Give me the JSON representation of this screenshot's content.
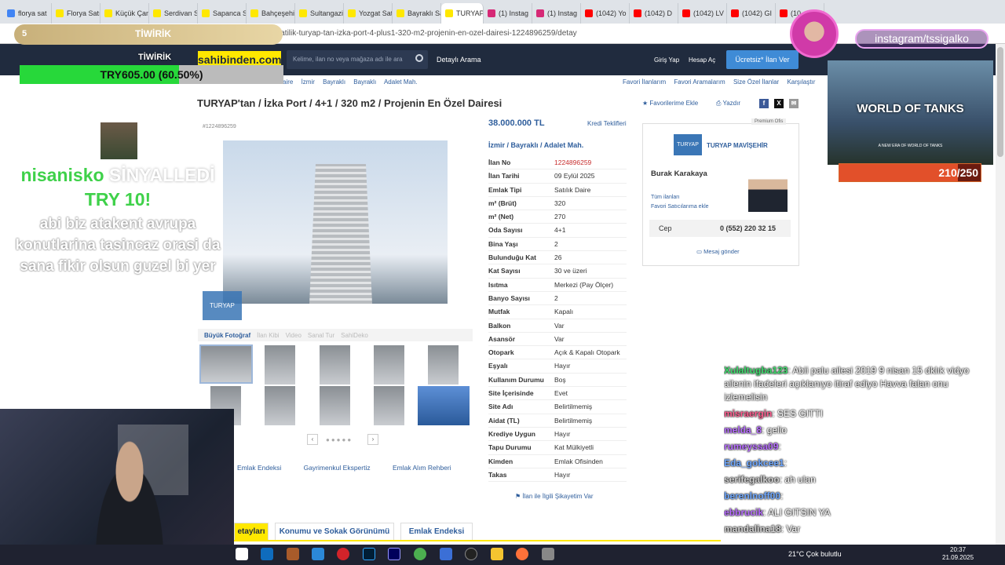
{
  "browser": {
    "tabs": [
      {
        "label": "florya sat",
        "color": "#4285f4"
      },
      {
        "label": "Florya Satılık",
        "color": "#ffe800"
      },
      {
        "label": "Küçük Çamlı",
        "color": "#ffe800"
      },
      {
        "label": "Serdivan Sat",
        "color": "#ffe800"
      },
      {
        "label": "Sapanca Satı",
        "color": "#ffe800"
      },
      {
        "label": "Bahçeşehir S",
        "color": "#ffe800"
      },
      {
        "label": "Sultangazi Sa",
        "color": "#ffe800"
      },
      {
        "label": "Yozgat Satılık",
        "color": "#ffe800"
      },
      {
        "label": "Bayraklı Satıl",
        "color": "#ffe800"
      },
      {
        "label": "TURYAP'ta",
        "color": "#ffe800",
        "active": true
      },
      {
        "label": "(1) Instag",
        "color": "#d62976"
      },
      {
        "label": "(1) Instag",
        "color": "#d62976"
      },
      {
        "label": "(1042) Yo",
        "color": "#ff0000"
      },
      {
        "label": "(1042) D",
        "color": "#ff0000"
      },
      {
        "label": "(1042) LV",
        "color": "#ff0000"
      },
      {
        "label": "(1042) GI",
        "color": "#ff0000"
      },
      {
        "label": "(10",
        "color": "#ff0000"
      }
    ],
    "url": "mlak-konut-satilik-turyap-tan-izka-port-4-plus1-320-m2-projenin-en-ozel-dairesi-1224896259/detay",
    "url_prefix": "en.com/ila"
  },
  "site": {
    "logo": "sahibinden.com",
    "search_placeholder": "Kelime, ilan no veya mağaza adı ile ara",
    "advanced_search": "Detaylı Arama",
    "login": "Giriş Yap",
    "register": "Hesap Aç",
    "post_ad": "Ücretsiz* İlan Ver"
  },
  "breadcrumb": [
    "aire",
    "İzmir",
    "Bayraklı",
    "Bayraklı",
    "Adalet Mah."
  ],
  "right_links": [
    "Favori İlanlarım",
    "Favori Aramalarım",
    "Size Özel İlanlar",
    "Karşılaştır"
  ],
  "listing": {
    "title": "TURYAP'tan / İzka Port / 4+1 / 320 m2 / Projenin En Özel Dairesi",
    "add_favorite": "Favorilerime Ekle",
    "print": "Yazdır",
    "listing_no_label": "#1224896259",
    "price": "38.000.000 TL",
    "credit": "Kredi Teklifleri",
    "location": "İzmir  /  Bayraklı  /  Adalet Mah.",
    "details": [
      {
        "k": "İlan No",
        "v": "1224896259",
        "red": true
      },
      {
        "k": "İlan Tarihi",
        "v": "09 Eylül 2025"
      },
      {
        "k": "Emlak Tipi",
        "v": "Satılık Daire"
      },
      {
        "k": "m² (Brüt)",
        "v": "320"
      },
      {
        "k": "m² (Net)",
        "v": "270"
      },
      {
        "k": "Oda Sayısı",
        "v": "4+1"
      },
      {
        "k": "Bina Yaşı",
        "v": "2"
      },
      {
        "k": "Bulunduğu Kat",
        "v": "26"
      },
      {
        "k": "Kat Sayısı",
        "v": "30 ve üzeri"
      },
      {
        "k": "Isıtma",
        "v": "Merkezi (Pay Ölçer)"
      },
      {
        "k": "Banyo Sayısı",
        "v": "2"
      },
      {
        "k": "Mutfak",
        "v": "Kapalı"
      },
      {
        "k": "Balkon",
        "v": "Var"
      },
      {
        "k": "Asansör",
        "v": "Var"
      },
      {
        "k": "Otopark",
        "v": "Açık & Kapalı Otopark"
      },
      {
        "k": "Eşyalı",
        "v": "Hayır"
      },
      {
        "k": "Kullanım Durumu",
        "v": "Boş"
      },
      {
        "k": "Site İçerisinde",
        "v": "Evet"
      },
      {
        "k": "Site Adı",
        "v": "Belirtilmemiş"
      },
      {
        "k": "Aidat (TL)",
        "v": "Belirtilmemiş"
      },
      {
        "k": "Krediye Uygun",
        "v": "Hayır"
      },
      {
        "k": "Tapu Durumu",
        "v": "Kat Mülkiyetli"
      },
      {
        "k": "Kimden",
        "v": "Emlak Ofisinden"
      },
      {
        "k": "Takas",
        "v": "Hayır"
      }
    ],
    "complaint": "İlan ile İlgili Şikayetim Var",
    "gallery_tabs": [
      "Büyük Fotoğraf",
      "İlan Kibi",
      "Video",
      "Sanal Tur",
      "SahiDeko"
    ],
    "watermark": "TURYAP MAVİŞEHİR"
  },
  "seller": {
    "premium": "Premium Ofis",
    "store_logo": "TURYAP",
    "store_name": "TURYAP MAVİŞEHİR",
    "agent": "Burak Karakaya",
    "all_ads": "Tüm ilanları",
    "add_fav_seller": "Favori Satıcılarıma ekle",
    "phone_label": "Cep",
    "phone": "0 (552) 220 32 15",
    "message": "Mesaj gönder"
  },
  "bottom_links": [
    "Emlak Endeksi",
    "Gayrimenkul Ekspertiz",
    "Emlak Alım Rehberi"
  ],
  "bottom_tabs": [
    "etayları",
    "Konumu ve Sokak Görünümü",
    "Emlak Endeksi"
  ],
  "overlay": {
    "dono_num": "5",
    "dono_title": "TİWİRİK",
    "goal_name": "TİWİRİK",
    "goal_text": "TRY605.00 (60.50%)",
    "goal_fraction": 0.605,
    "alert_name": "nisanisko",
    "alert_action": " SİNYALLEDİ",
    "alert_amount": "TRY 10!",
    "alert_message": "abi biz atakent avrupa konutlarina tasincaz orasi da sana fikir olsun guzel bi yer",
    "insta": "instagram/tssigalko",
    "game_title": "WORLD OF TANKS",
    "game_sub": "A NEW ERA OF WORLD OF TANKS",
    "progress_text": "210/250",
    "progress_fraction": 0.84
  },
  "chat": [
    {
      "user": "",
      "msg": "",
      "color": "#9ccfff"
    },
    {
      "user": "Xulaltugba123",
      "msg": ": Abii palu ailesi 2019 9 nisan 15 dklık vidyo ailenin ifadeleri açıklanıyo itiraf ediyo Havva falan onu izlemelisin",
      "color": "#3ddc6c"
    },
    {
      "user": "misraergin",
      "msg": ": SES GITTI",
      "color": "#ff5d8f"
    },
    {
      "user": "melda_8",
      "msg": ": gelio",
      "color": "#b76cff"
    },
    {
      "user": "rumeyssa09",
      "msg": ": ",
      "color": "#b76cff"
    },
    {
      "user": "Eda_gokcee1",
      "msg": ": ",
      "color": "#6fa8ff"
    },
    {
      "user": "serifegalkoo",
      "msg": ": ah ulan",
      "color": "#cfcfcf"
    },
    {
      "user": "berenlnoff00",
      "msg": ": ",
      "color": "#6fa8ff"
    },
    {
      "user": "ebbrucik",
      "msg": ": ALI GITSIN YA",
      "color": "#b76cff"
    },
    {
      "user": "mandalina18",
      "msg": ": Var",
      "color": "#cfcfcf"
    }
  ],
  "taskbar": {
    "weather": "21°C  Çok bulutlu",
    "time": "20:37",
    "date": "21.09.2025"
  }
}
